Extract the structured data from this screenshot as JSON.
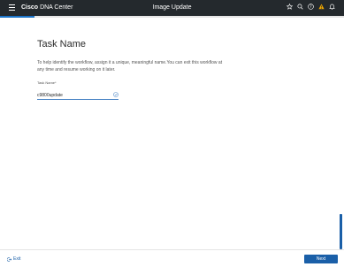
{
  "header": {
    "brand_bold": "Cisco",
    "brand_rest": "DNA Center",
    "title": "Image Update",
    "icons": [
      "hamburger-icon",
      "star-icon",
      "search-icon",
      "help-icon",
      "warning-icon",
      "bell-icon"
    ],
    "warning_color": "#f0a800"
  },
  "progress": {
    "fraction": 0.1,
    "color": "#1a73c8"
  },
  "main": {
    "heading": "Task Name",
    "description": "To help identify the workflow, assign it a unique, meaningful name.You can exit this workflow at any time and resume working on it later.",
    "task_name_field": {
      "label": "Task Name*",
      "value": "c9800update"
    }
  },
  "footer": {
    "exit_label": "Exit",
    "next_label": "Next",
    "accent": "#1a5fa8"
  }
}
